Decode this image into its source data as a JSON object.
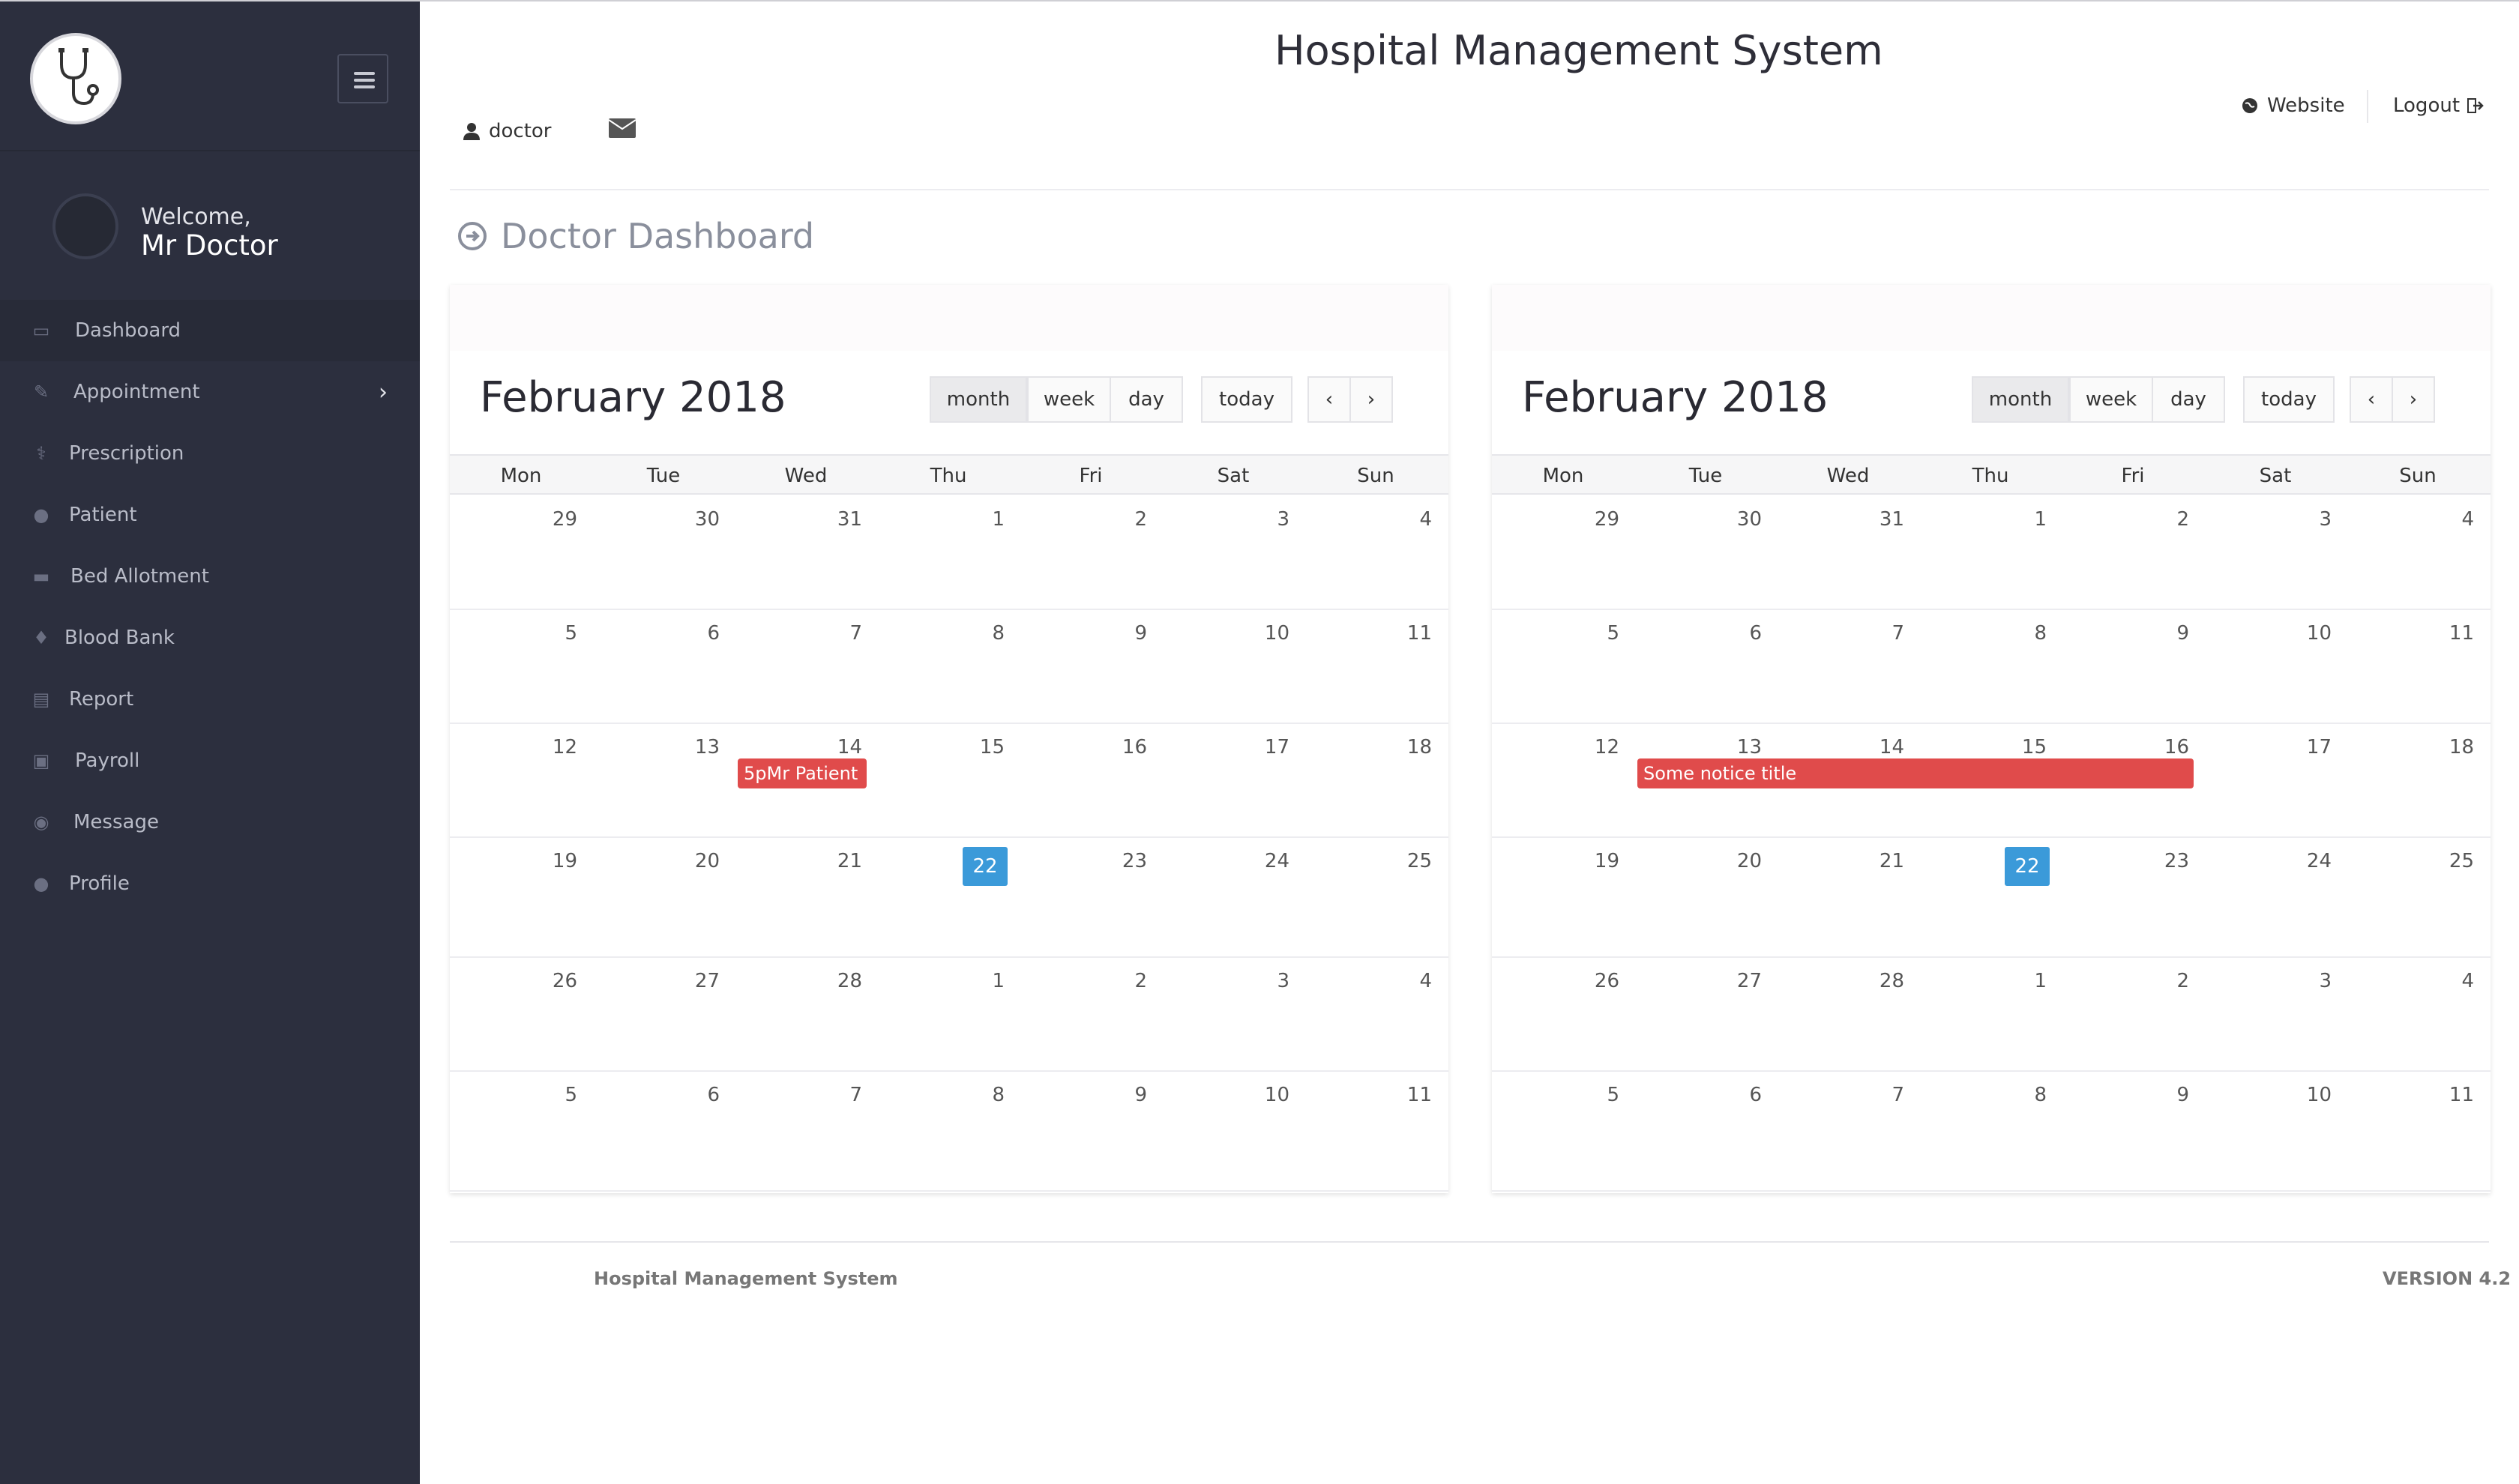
{
  "app": {
    "title": "Hospital Management System"
  },
  "header": {
    "user": "doctor",
    "website": "Website",
    "logout": "Logout"
  },
  "sidebar": {
    "welcome": "Welcome,",
    "doctor_name": "Mr Doctor",
    "items": [
      {
        "label": "Dashboard",
        "icon": "monitor-icon"
      },
      {
        "label": "Appointment",
        "icon": "edit-icon"
      },
      {
        "label": "Prescription",
        "icon": "stethoscope-icon"
      },
      {
        "label": "Patient",
        "icon": "user-icon"
      },
      {
        "label": "Bed Allotment",
        "icon": "bed-icon"
      },
      {
        "label": "Blood Bank",
        "icon": "drop-icon"
      },
      {
        "label": "Report",
        "icon": "clipboard-icon"
      },
      {
        "label": "Payroll",
        "icon": "money-icon"
      },
      {
        "label": "Message",
        "icon": "chat-icon"
      },
      {
        "label": "Profile",
        "icon": "user-icon"
      }
    ]
  },
  "page": {
    "title": "Doctor Dashboard"
  },
  "weekday_headers": [
    "Mon",
    "Tue",
    "Wed",
    "Thu",
    "Fri",
    "Sat",
    "Sun"
  ],
  "calendars": [
    {
      "title": "February 2018",
      "buttons": {
        "month": "month",
        "week": "week",
        "day": "day",
        "today": "today",
        "prev": "‹",
        "next": "›"
      },
      "weeks": [
        [
          "29",
          "30",
          "31",
          "1",
          "2",
          "3",
          "4"
        ],
        [
          "5",
          "6",
          "7",
          "8",
          "9",
          "10",
          "11"
        ],
        [
          "12",
          "13",
          "14",
          "15",
          "16",
          "17",
          "18"
        ],
        [
          "19",
          "20",
          "21",
          "22",
          "23",
          "24",
          "25"
        ],
        [
          "26",
          "27",
          "28",
          "1",
          "2",
          "3",
          "4"
        ],
        [
          "5",
          "6",
          "7",
          "8",
          "9",
          "10",
          "11"
        ]
      ],
      "today": "22",
      "event": "5pMr Patient"
    },
    {
      "title": "February 2018",
      "buttons": {
        "month": "month",
        "week": "week",
        "day": "day",
        "today": "today",
        "prev": "‹",
        "next": "›"
      },
      "weeks": [
        [
          "29",
          "30",
          "31",
          "1",
          "2",
          "3",
          "4"
        ],
        [
          "5",
          "6",
          "7",
          "8",
          "9",
          "10",
          "11"
        ],
        [
          "12",
          "13",
          "14",
          "15",
          "16",
          "17",
          "18"
        ],
        [
          "19",
          "20",
          "21",
          "22",
          "23",
          "24",
          "25"
        ],
        [
          "26",
          "27",
          "28",
          "1",
          "2",
          "3",
          "4"
        ],
        [
          "5",
          "6",
          "7",
          "8",
          "9",
          "10",
          "11"
        ]
      ],
      "today": "22",
      "event": "Some notice title"
    }
  ],
  "footer": {
    "left": "Hospital Management System",
    "right": "VERSION 4.2"
  },
  "colors": {
    "sidebar": "#2c2f3e",
    "today": "#3b9ad9",
    "event": "#e04b4b"
  }
}
